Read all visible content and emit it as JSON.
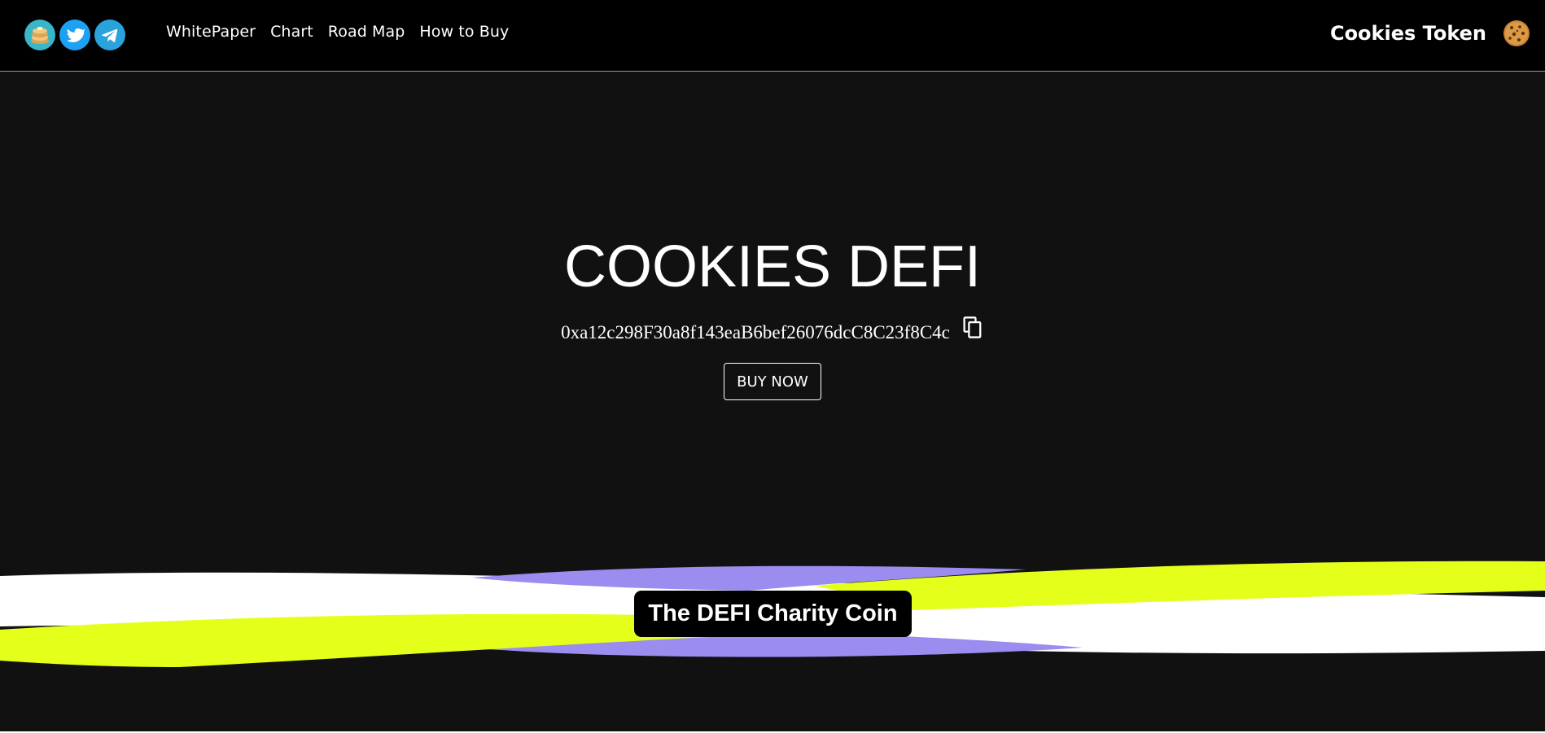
{
  "nav": {
    "socials": [
      {
        "icon": "pancakeswap-icon",
        "color": "#39b6c8"
      },
      {
        "icon": "twitter-icon",
        "color": "#1da1f2"
      },
      {
        "icon": "telegram-icon",
        "color": "#2aa3dc"
      }
    ],
    "links": [
      "WhitePaper",
      "Chart",
      "Road Map",
      "How to Buy"
    ],
    "brand_name": "Cookies Token",
    "brand_icon": "cookie-icon"
  },
  "hero": {
    "title": "COOKIES DEFI",
    "contract_address": "0xa12c298F30a8f143eaB6bef26076dcC8C23f8C4c",
    "copy_icon": "copy-icon",
    "buy_label": "BUY NOW"
  },
  "banner": {
    "tagline": "The DEFI Charity Coin"
  },
  "colors": {
    "background": "#111111",
    "navbar": "#000000",
    "wave_yellow": "#e4ff1a",
    "wave_purple": "#9b8cf0",
    "wave_white": "#ffffff"
  }
}
